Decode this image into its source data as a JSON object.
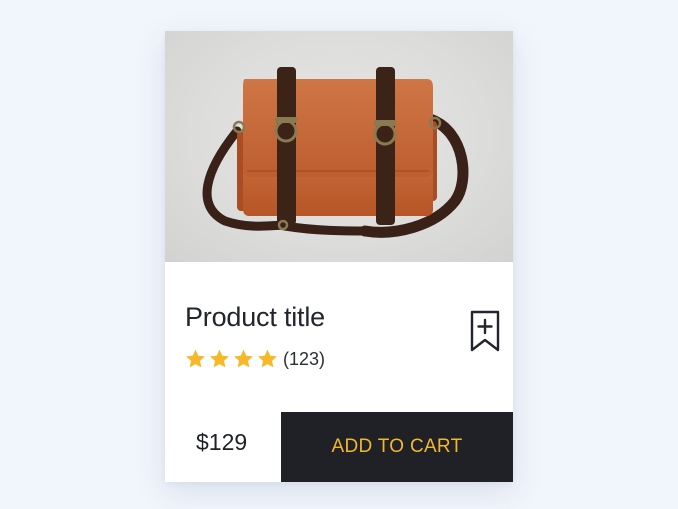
{
  "product": {
    "title": "Product title",
    "review_count": "(123)",
    "rating_stars": 4,
    "price": "$129",
    "image_icon": "leather-messenger-bag"
  },
  "actions": {
    "add_to_cart_label": "ADD TO CART",
    "bookmark_icon": "bookmark-add-icon"
  },
  "colors": {
    "page_background": "#f1f5fc",
    "star": "#f5b92a",
    "button_background": "#1f2126",
    "button_text": "#f3b72b",
    "title_text": "#22252b"
  }
}
